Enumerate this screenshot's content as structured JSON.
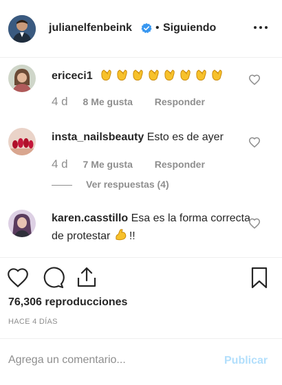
{
  "header": {
    "username": "julianelfenbeink",
    "dot": "•",
    "follow_status": "Siguiendo"
  },
  "comments": [
    {
      "username": "ericeci1",
      "text": "",
      "emoji": "👏 x8",
      "time": "4 d",
      "likes": "8 Me gusta",
      "reply": "Responder"
    },
    {
      "username": "insta_nailsbeauty",
      "text": "Esto es de ayer",
      "time": "4 d",
      "likes": "7 Me gusta",
      "reply": "Responder",
      "view_replies": "Ver respuestas (4)"
    },
    {
      "username": "karen.casstillo",
      "text": "Esa es la forma correcta de protestar",
      "emoji_suffix": "💪!!"
    }
  ],
  "post": {
    "views": "76,306 reproducciones",
    "ago": "HACE 4 DÍAS"
  },
  "comment_box": {
    "placeholder": "Agrega un comentario...",
    "publish": "Publicar"
  },
  "colors": {
    "text": "#262626",
    "muted": "#8e8e8e",
    "verified": "#3897f0",
    "publish_disabled": "#b2dffc",
    "divider": "#efefef"
  },
  "icons": [
    "more-options-icon",
    "verified-badge-icon",
    "heart-icon",
    "comment-icon",
    "share-icon",
    "bookmark-icon",
    "clapping-hands-icon",
    "flexed-biceps-icon"
  ]
}
